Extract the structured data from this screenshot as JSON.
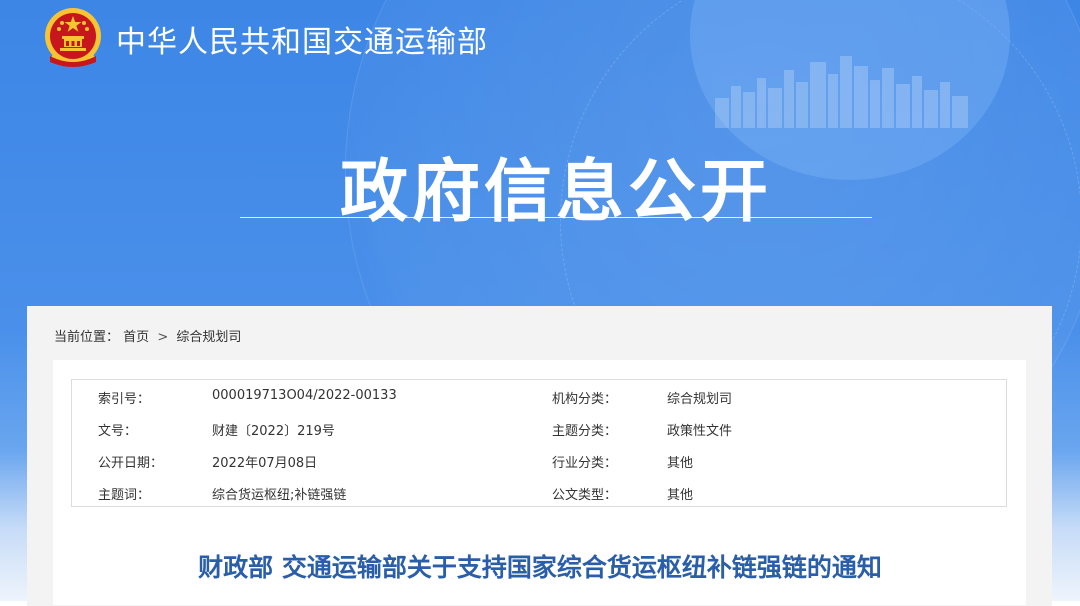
{
  "header": {
    "ministry_name": "中华人民共和国交通运输部",
    "page_title": "政府信息公开"
  },
  "breadcrumb": {
    "prefix": "当前位置：",
    "items": [
      "首页",
      "综合规划司"
    ],
    "separator": ">"
  },
  "meta": {
    "rows": [
      {
        "key1": "索引号：",
        "val1": "000019713O04/2022-00133",
        "key2": "机构分类：",
        "val2": "综合规划司"
      },
      {
        "key1": "文号：",
        "val1": "财建〔2022〕219号",
        "key2": "主题分类：",
        "val2": "政策性文件"
      },
      {
        "key1": "公开日期：",
        "val1": "2022年07月08日",
        "key2": "行业分类：",
        "val2": "其他"
      },
      {
        "key1": "主题词：",
        "val1": "综合货运枢纽;补链强链",
        "key2": "公文类型：",
        "val2": "其他"
      }
    ]
  },
  "document": {
    "title": "财政部 交通运输部关于支持国家综合货运枢纽补链强链的通知"
  },
  "colors": {
    "banner_blue": "#4a90ea",
    "title_blue": "#2b5ea9",
    "emblem_red": "#c8161d",
    "emblem_gold": "#f7c531"
  },
  "icons": {
    "emblem": "national-emblem-icon"
  }
}
